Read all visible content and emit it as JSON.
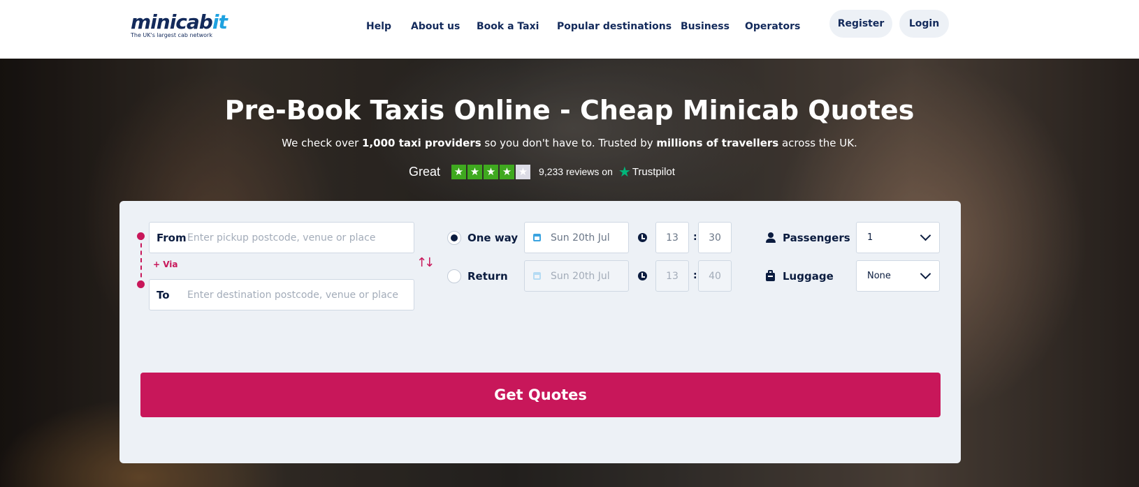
{
  "brand": {
    "logo_main": "minicab",
    "logo_accent": "it",
    "tagline": "The UK's largest cab network",
    "accent_color": "#c8175a",
    "navy_color": "#132a5b"
  },
  "nav": {
    "items": [
      "Help",
      "About us",
      "Book a Taxi",
      "Popular destinations",
      "Business",
      "Operators"
    ],
    "register": "Register",
    "login": "Login"
  },
  "hero": {
    "title": "Pre-Book Taxis Online - Cheap Minicab Quotes",
    "sub_pre": "We check over ",
    "sub_bold1": "1,000 taxi providers",
    "sub_mid": " so you don't have to. Trusted by ",
    "sub_bold2": "millions of travellers",
    "sub_post": " across the UK."
  },
  "trustpilot": {
    "rating_word": "Great",
    "stars_filled": 4,
    "stars_total": 5,
    "reviews_text": "9,233 reviews on",
    "brand": "Trustpilot",
    "star_color": "#3fa91f"
  },
  "form": {
    "from_label": "From",
    "from_placeholder": "Enter pickup postcode, venue or place",
    "via_label": "+ Via",
    "to_label": "To",
    "to_placeholder": "Enter destination postcode, venue or place",
    "swap_icon": "↑↓",
    "one_way": {
      "label": "One way",
      "selected": true,
      "date": "Sun 20th Jul",
      "hour": "13",
      "minute": "30"
    },
    "return": {
      "label": "Return",
      "selected": false,
      "date": "Sun 20th Jul",
      "hour": "13",
      "minute": "40"
    },
    "time_separator": ":",
    "passengers": {
      "label": "Passengers",
      "value": "1"
    },
    "luggage": {
      "label": "Luggage",
      "value": "None"
    },
    "submit": "Get Quotes"
  }
}
